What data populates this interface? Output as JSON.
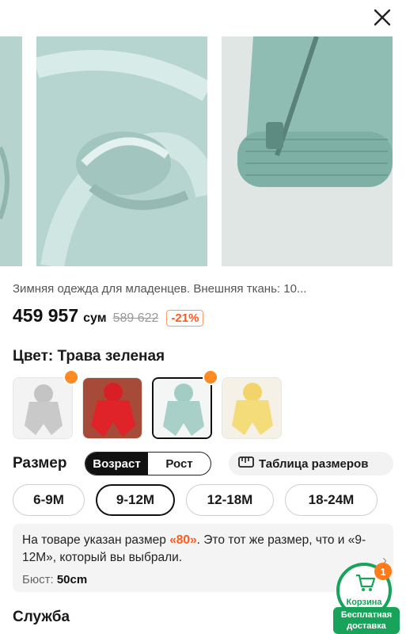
{
  "product": {
    "title": "Зимняя одежда для младенцев. Внешняя ткань: 10...",
    "price": "459 957",
    "currency": "сум",
    "old_price": "589 622",
    "discount": "-21%"
  },
  "color": {
    "label": "Цвет: Трава зеленая",
    "swatches": [
      {
        "name": "gray",
        "color": "#c9c9c9",
        "hot": true
      },
      {
        "name": "red",
        "color": "#d91f26",
        "hot": false
      },
      {
        "name": "mint",
        "color": "#a8cfc8",
        "hot": true,
        "selected": true
      },
      {
        "name": "yellow",
        "color": "#f4dc7a",
        "hot": false
      }
    ]
  },
  "size": {
    "label": "Размер",
    "tabs": [
      "Возраст",
      "Рост"
    ],
    "active_tab": "Возраст",
    "chart_label": "Таблица размеров",
    "options": [
      "6-9M",
      "9-12M",
      "12-18M",
      "18-24M"
    ],
    "selected": "9-12M"
  },
  "notice": {
    "part1": "На товаре указан размер ",
    "highlight": "«80»",
    "part2": ". Это тот же размер, что и «9-12M», который вы выбрали.",
    "bust_label": "Бюст:",
    "bust_value": "50cm"
  },
  "service": {
    "title": "Служба"
  },
  "cart": {
    "label": "Корзина",
    "count": "1",
    "delivery": "Бесплатная доставка"
  },
  "colors": {
    "accent": "#ff5a1f",
    "green": "#19a35a"
  }
}
